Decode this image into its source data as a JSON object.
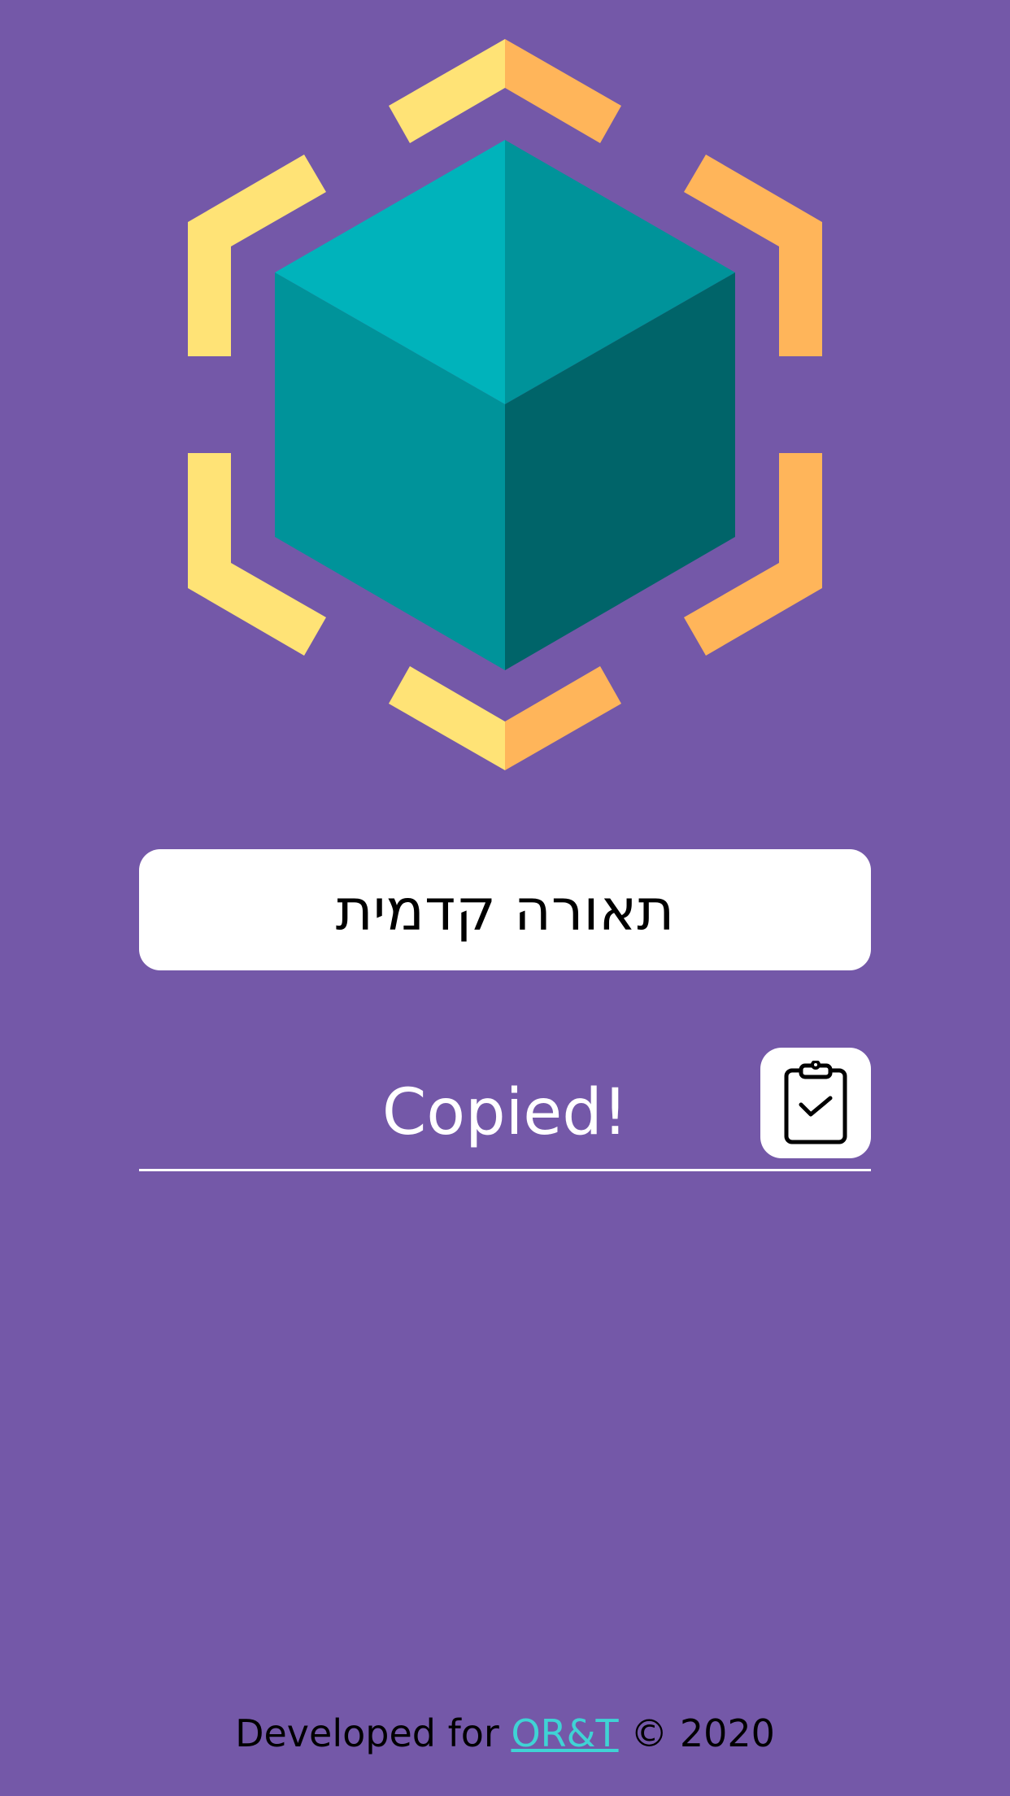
{
  "colors": {
    "background": "#7458a8",
    "cube_top_left": "#00b3bb",
    "cube_top_right": "#00939a",
    "cube_left": "#00939a",
    "cube_right": "#006469",
    "bracket_yellow": "#ffe376",
    "bracket_orange": "#ffb55a",
    "link": "#3fd3d5"
  },
  "title": {
    "text": "תאורה קדמית"
  },
  "copy": {
    "status_text": "Copied!",
    "button_icon": "clipboard-check-icon"
  },
  "logo": {
    "icon": "cube-icon"
  },
  "footer": {
    "prefix": "Developed for ",
    "link_text": "OR&T",
    "suffix": " © 2020"
  }
}
